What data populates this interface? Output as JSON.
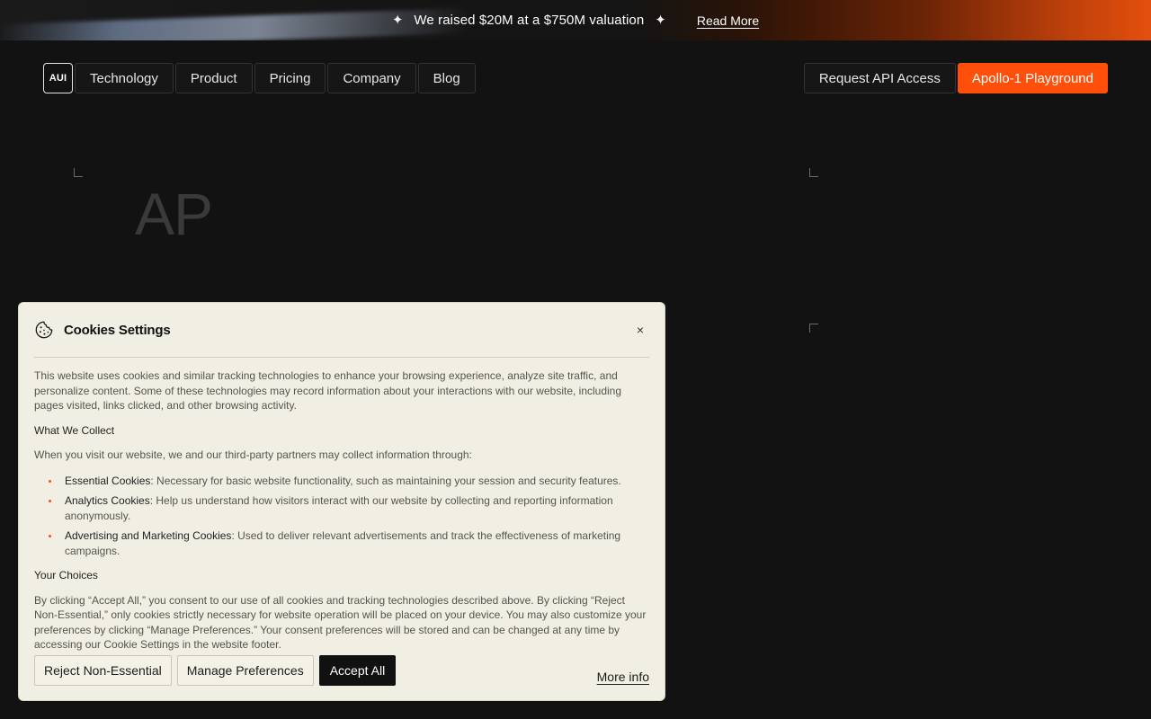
{
  "banner": {
    "text": "We raised $20M at a $750M valuation",
    "link": "Read More",
    "sparkle_icon": "sparkle-icon"
  },
  "nav": {
    "logo": "AUI",
    "items": [
      "Technology",
      "Product",
      "Pricing",
      "Company",
      "Blog"
    ],
    "request_api": "Request API Access",
    "playground": "Apollo-1 Playground"
  },
  "hero": {
    "title": "AP"
  },
  "cookie": {
    "title": "Cookies Settings",
    "close": "×",
    "intro": "This website uses cookies and similar tracking technologies to enhance your browsing experience, analyze site traffic, and personalize content. Some of these technologies may record information about your interactions with our website, including pages visited, links clicked, and other browsing activity.",
    "collect_heading": "What We Collect",
    "collect_intro": "When you visit our website, we and our third-party partners may collect information through:",
    "items": [
      {
        "term": "Essential Cookies",
        "desc": ": Necessary for basic website functionality, such as maintaining your session and security features."
      },
      {
        "term": "Analytics Cookies",
        "desc": ": Help us understand how visitors interact with our website by collecting and reporting information anonymously."
      },
      {
        "term": "Advertising and Marketing Cookies",
        "desc": ": Used to deliver relevant advertisements and track the effectiveness of marketing campaigns."
      }
    ],
    "choices_heading": "Your Choices",
    "choices_text": "By clicking “Accept All,” you consent to our use of all cookies and tracking technologies described above. By clicking “Reject Non-Essential,” only cookies strictly necessary for website operation will be placed on your device. You may also customize your preferences by clicking “Manage Preferences.” Your consent preferences will be stored and can be changed at any time by accessing our Cookie Settings in the website footer.",
    "reject": "Reject Non-Essential",
    "manage": "Manage Preferences",
    "accept": "Accept All",
    "more_info": "More info"
  },
  "colors": {
    "accent": "#ff4f0a",
    "background": "#121212",
    "modal": "#f1efe3"
  }
}
